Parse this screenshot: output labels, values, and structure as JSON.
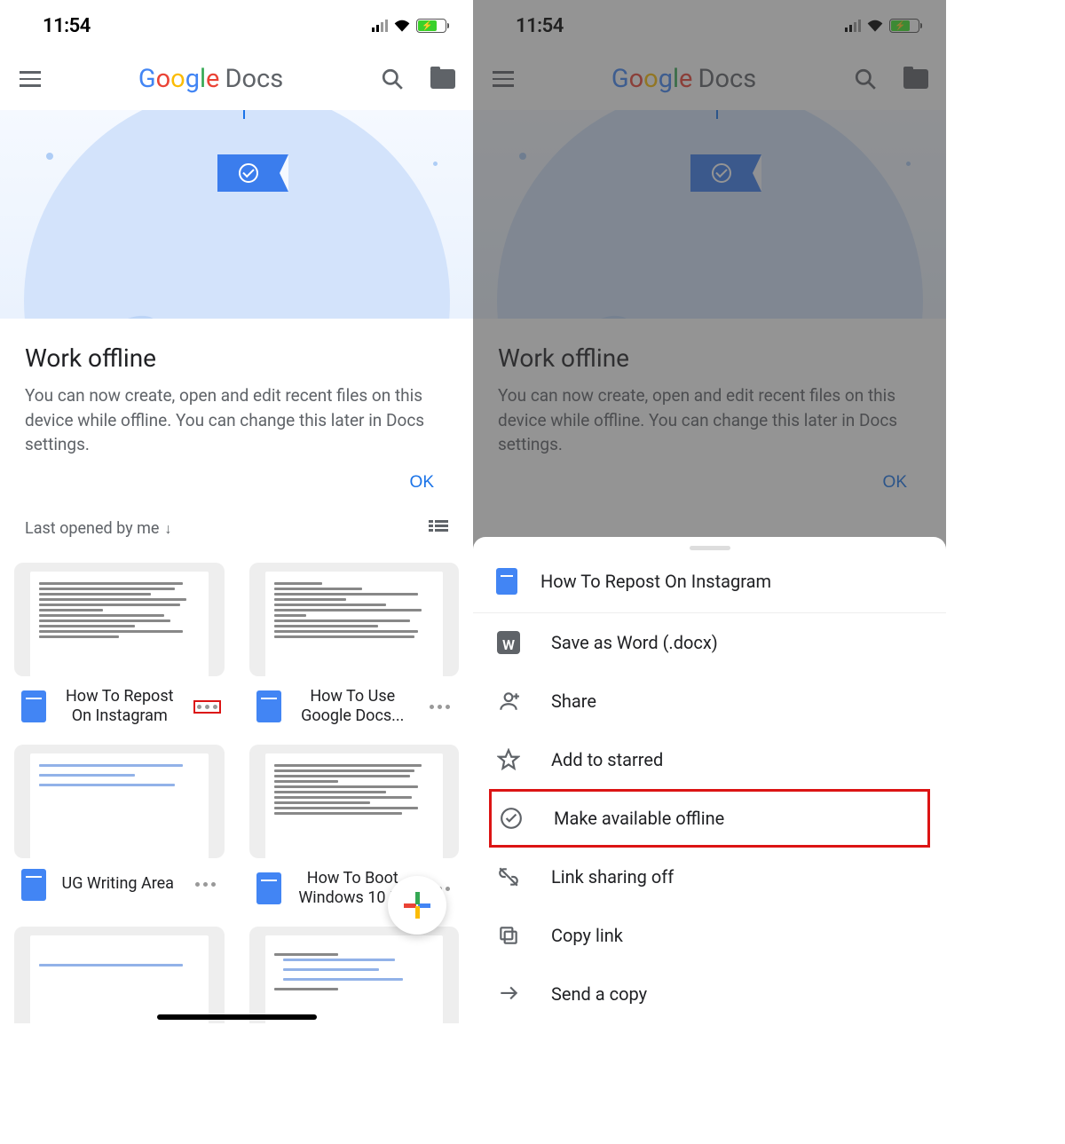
{
  "status": {
    "time": "11:54"
  },
  "header": {
    "logo_brand": "Google",
    "logo_product": "Docs"
  },
  "notice": {
    "title": "Work offline",
    "body": "You can now create, open and edit recent files on this device while offline. You can change this later in Docs settings.",
    "ok": "OK"
  },
  "sort": {
    "label": "Last opened by me"
  },
  "docs": [
    {
      "title": "How To Repost On Instagram"
    },
    {
      "title": "How To Use Google Docs..."
    },
    {
      "title": "UG Writing Area"
    },
    {
      "title": "How To Boot Windows 10 I..."
    }
  ],
  "sheet": {
    "doc_title": "How To Repost On Instagram",
    "items": [
      {
        "label": "Save as Word (.docx)",
        "icon": "word-icon"
      },
      {
        "label": "Share",
        "icon": "person-add-icon"
      },
      {
        "label": "Add to starred",
        "icon": "star-icon"
      },
      {
        "label": "Make available offline",
        "icon": "offline-check-icon",
        "highlight": true
      },
      {
        "label": "Link sharing off",
        "icon": "link-off-icon"
      },
      {
        "label": "Copy link",
        "icon": "copy-icon"
      },
      {
        "label": "Send a copy",
        "icon": "send-icon"
      }
    ]
  }
}
